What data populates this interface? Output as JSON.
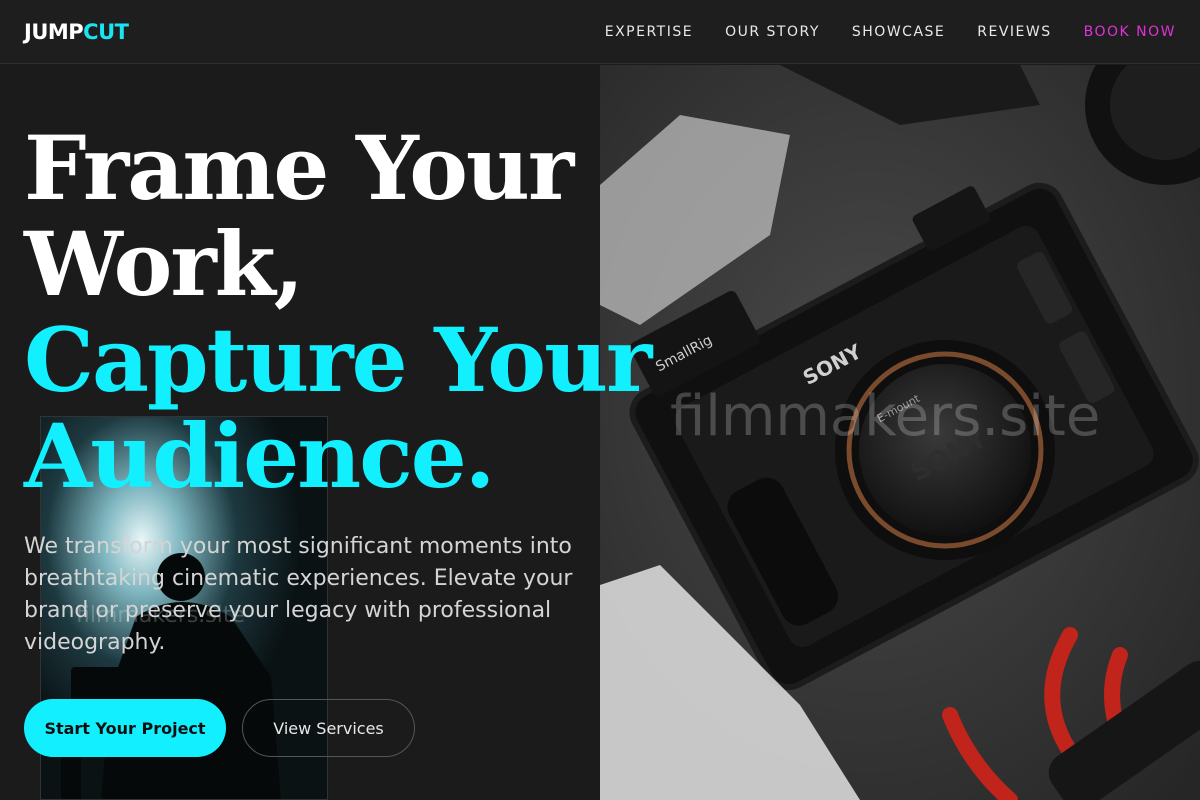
{
  "header": {
    "logo": {
      "part1": "JUMP",
      "part2": "CUT"
    },
    "nav": [
      {
        "label": "EXPERTISE"
      },
      {
        "label": "OUR STORY"
      },
      {
        "label": "SHOWCASE"
      },
      {
        "label": "REVIEWS"
      },
      {
        "label": "BOOK NOW"
      }
    ]
  },
  "hero": {
    "headline": {
      "line1": "Frame Your",
      "line2": "Work,",
      "line3": "Capture Your",
      "line4": "Audience."
    },
    "description": "We transform your most significant moments into breathtaking cinematic experiences. Elevate your brand or preserve your legacy with professional videography.",
    "primary_button": "Start Your Project",
    "secondary_button": "View Services"
  },
  "images": {
    "main_watermark": "filmmakers.site",
    "inset_watermark": "filmmakers.site",
    "camera_brand": "SONY",
    "mount_text": "E-mount",
    "rig_brand": "SmallRig"
  },
  "colors": {
    "accent_cyan": "#12f0ff",
    "accent_magenta": "#e032d8",
    "background": "#1b1b1b"
  }
}
